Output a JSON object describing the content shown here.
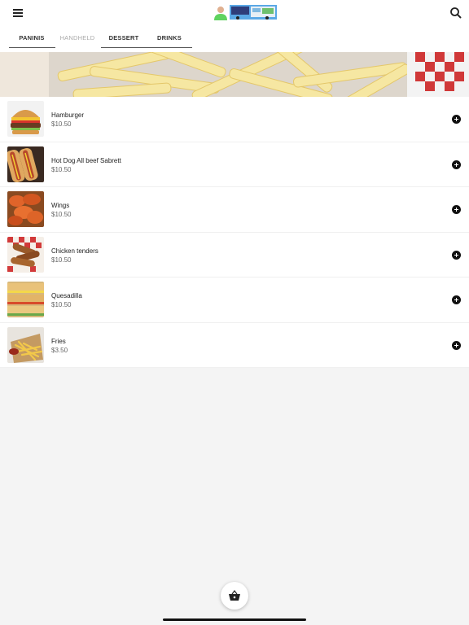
{
  "header": {
    "menu_icon": "hamburger-menu-icon",
    "logo_icon": "restaurant-logo",
    "search_icon": "search-icon"
  },
  "tabs": [
    {
      "label": "PANINIS",
      "disabled": false
    },
    {
      "label": "HANDHELD",
      "disabled": true
    },
    {
      "label": "DESSERT",
      "disabled": false
    },
    {
      "label": "DRINKS",
      "disabled": false
    }
  ],
  "items": [
    {
      "name": "Hamburger",
      "price": "$10.50",
      "image": "hamburger-photo"
    },
    {
      "name": "Hot Dog All beef Sabrett",
      "price": "$10.50",
      "image": "hot-dog-photo"
    },
    {
      "name": "Wings",
      "price": "$10.50",
      "image": "wings-photo"
    },
    {
      "name": "Chicken tenders",
      "price": "$10.50",
      "image": "chicken-tenders-photo"
    },
    {
      "name": "Quesadilla",
      "price": "$10.50",
      "image": "quesadilla-photo"
    },
    {
      "name": "Fries",
      "price": "$3.50",
      "image": "fries-photo"
    }
  ],
  "cart": {
    "icon": "shopping-basket-icon"
  }
}
